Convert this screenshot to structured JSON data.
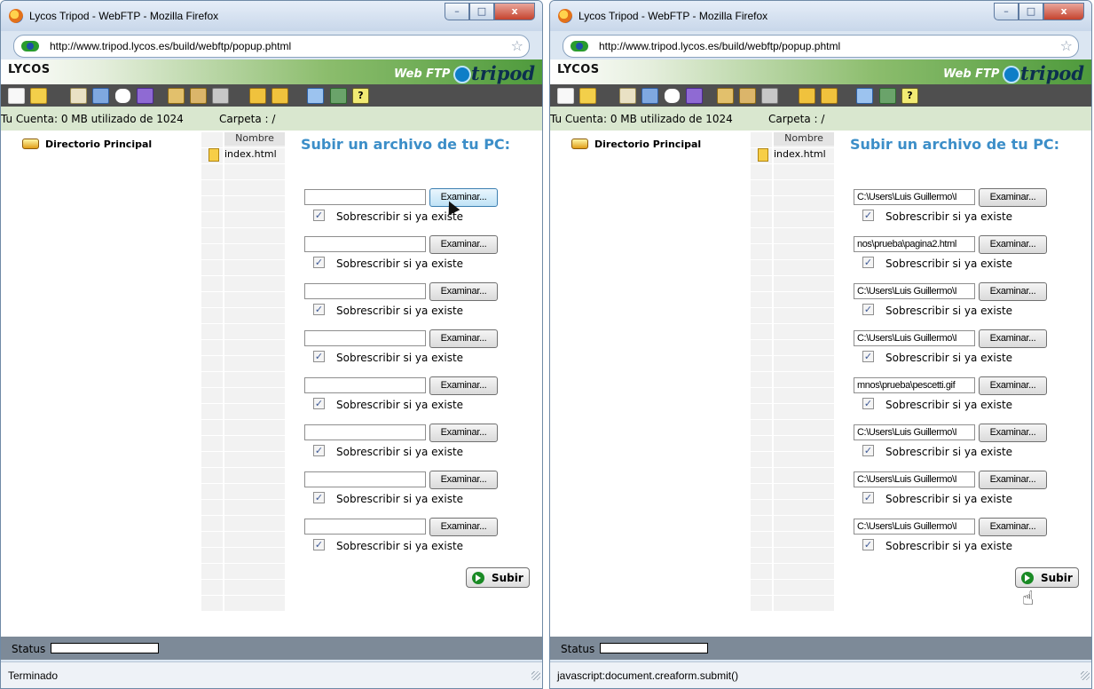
{
  "windows": [
    {
      "title": "Lycos Tripod - WebFTP - Mozilla Firefox",
      "url": "http://www.tripod.lycos.es/build/webftp/popup.phtml",
      "header": {
        "lycos": "LYCOS",
        "webftp": "Web FTP",
        "tripod": "tripod"
      },
      "account": {
        "usage": "Tu Cuenta: 0 MB utilizado de 1024",
        "folder": "Carpeta : /"
      },
      "tree": {
        "root": "Directorio Principal"
      },
      "files": {
        "column": "Nombre",
        "items": [
          "index.html"
        ]
      },
      "upload": {
        "title": "Subir un archivo de tu PC:",
        "browse_label": "Examinar...",
        "overwrite_label": "Sobrescribir si ya existe",
        "paths": [
          "",
          "",
          "",
          "",
          "",
          "",
          "",
          ""
        ],
        "submit_label": "Subir"
      },
      "status_label": "Status",
      "browser_status": "Terminado"
    },
    {
      "title": "Lycos Tripod - WebFTP - Mozilla Firefox",
      "url": "http://www.tripod.lycos.es/build/webftp/popup.phtml",
      "header": {
        "lycos": "LYCOS",
        "webftp": "Web FTP",
        "tripod": "tripod"
      },
      "account": {
        "usage": "Tu Cuenta: 0 MB utilizado de 1024",
        "folder": "Carpeta : /"
      },
      "tree": {
        "root": "Directorio Principal"
      },
      "files": {
        "column": "Nombre",
        "items": [
          "index.html"
        ]
      },
      "upload": {
        "title": "Subir un archivo de tu PC:",
        "browse_label": "Examinar...",
        "overwrite_label": "Sobrescribir si ya existe",
        "paths": [
          "C:\\Users\\Luis Guillermo\\I",
          "nos\\prueba\\pagina2.html",
          "C:\\Users\\Luis Guillermo\\I",
          "C:\\Users\\Luis Guillermo\\I",
          "mnos\\prueba\\pescetti.gif",
          "C:\\Users\\Luis Guillermo\\I",
          "C:\\Users\\Luis Guillermo\\I",
          "C:\\Users\\Luis Guillermo\\I"
        ],
        "submit_label": "Subir"
      },
      "status_label": "Status",
      "browser_status": "javascript:document.creaform.submit()"
    }
  ],
  "window_controls": {
    "minimize": "–",
    "maximize": "□",
    "close": "x"
  },
  "colors": {
    "upload_title": "#3c8ec8",
    "account_bar": "#d9e7cf",
    "toolbar": "#4f4f4f",
    "status_panel": "#7d8a98"
  },
  "icons": [
    "firefox-icon",
    "site-identity-icon",
    "bookmark-star-icon",
    "folder-icon",
    "file-icon",
    "upload-arrow-icon",
    "checkmark-icon",
    "pointer-cursor-icon",
    "hand-cursor-icon"
  ]
}
